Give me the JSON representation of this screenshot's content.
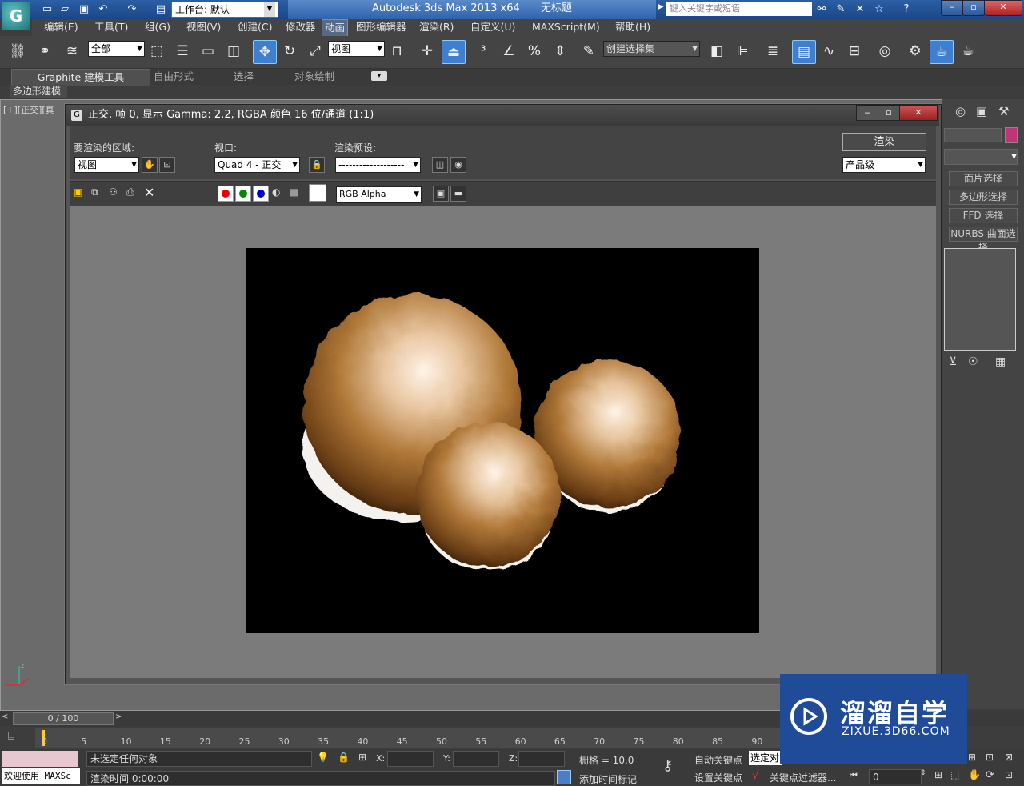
{
  "app": {
    "title": "Autodesk 3ds Max  2013 x64",
    "doc_title": "无标题",
    "workspace": "工作台: 默认",
    "search_placeholder": "键入关键字或短语"
  },
  "menu": [
    "编辑(E)",
    "工具(T)",
    "组(G)",
    "视图(V)",
    "创建(C)",
    "修改器",
    "动画",
    "图形编辑器",
    "渲染(R)",
    "自定义(U)",
    "MAXScript(M)",
    "帮助(H)"
  ],
  "menu_active": "动画",
  "toolbar": {
    "filter_value": "全部",
    "ref_coord": "视图",
    "selection_set": "创建选择集"
  },
  "ribbon": {
    "tabs": [
      "Graphite 建模工具",
      "自由形式",
      "选择",
      "对象绘制"
    ],
    "sub": "多边形建模"
  },
  "viewport_label": "[+][正交][真",
  "render_window": {
    "title": "正交, 帧 0, 显示 Gamma: 2.2, RGBA 颜色 16 位/通道 (1:1)",
    "area_label": "要渲染的区域:",
    "area_value": "视图",
    "viewport_label": "视口:",
    "viewport_value": "Quad 4 - 正交",
    "preset_label": "渲染预设:",
    "preset_value": "-------------------",
    "render_button": "渲染",
    "quality_value": "产品级",
    "channel_value": "RGB Alpha"
  },
  "right_panel": {
    "buttons": [
      "面片选择",
      "多边形选择",
      "FFD 选择",
      "NURBS 曲面选择"
    ]
  },
  "timeline": {
    "slider": "0 / 100",
    "ticks": [
      "0",
      "5",
      "10",
      "15",
      "20",
      "25",
      "30",
      "35",
      "40",
      "45",
      "50",
      "55",
      "60",
      "65",
      "70",
      "75",
      "80",
      "85",
      "90"
    ]
  },
  "status": {
    "maxscript": "欢迎使用 MAXSc",
    "selection": "未选定任何对象",
    "render_time": "渲染时间  0:00:00",
    "x_label": "X:",
    "y_label": "Y:",
    "z_label": "Z:",
    "grid": "栅格 = 10.0",
    "add_time_tag": "添加时间标记",
    "auto_key": "自动关键点",
    "set_key": "设置关键点",
    "selected": "选定对",
    "key_filters": "关键点过滤器...",
    "frame": "0"
  },
  "watermark": {
    "title": "溜溜自学",
    "subtitle": "ZIXUE.3D66.COM"
  },
  "colors": {
    "render_bg": "#000000",
    "sphere": "#b07838",
    "watermark_bg": "#1f4b99"
  }
}
